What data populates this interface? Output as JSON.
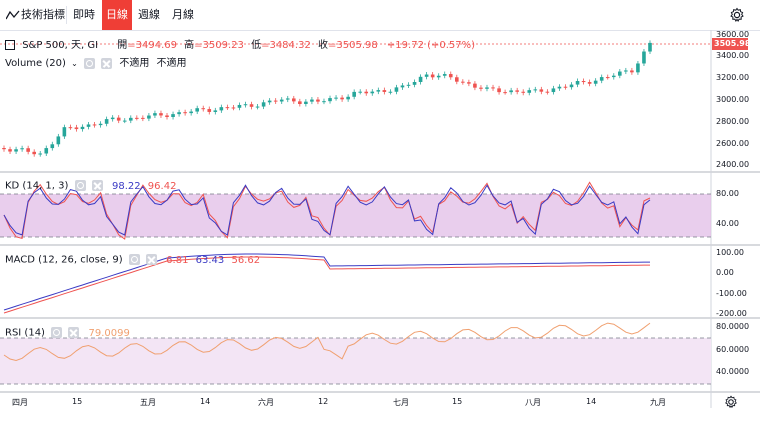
{
  "toolbar": {
    "indicators_label": "技術指標",
    "tabs": [
      {
        "label": "即時"
      },
      {
        "label": "日線",
        "active": true
      },
      {
        "label": "週線"
      },
      {
        "label": "月線"
      }
    ]
  },
  "main": {
    "symbol": "S&P 500, 天, GI",
    "open_label": "開",
    "open_value": "=3494.69",
    "high_label": "高",
    "high_value": "=3509.23",
    "low_label": "低",
    "low_value": "=3484.32",
    "close_label": "收",
    "close_value": "=3505.98",
    "change": "+19.72 (+0.57%)",
    "volume_label": "Volume (20)",
    "volume_na_1": "不適用",
    "volume_na_2": "不適用",
    "price_ticks": [
      "3600.00",
      "3400.00",
      "3200.00",
      "3000.00",
      "2800.00",
      "2600.00",
      "2400.00"
    ],
    "last_price_tag": "3505.98"
  },
  "kd": {
    "label": "KD (14, 1, 3)",
    "k_value": "98.22",
    "d_value": "96.42",
    "ticks": [
      "80.00",
      "40.00"
    ]
  },
  "macd": {
    "label": "MACD (12, 26, close, 9)",
    "v1": "6.81",
    "v2": "63.43",
    "v3": "56.62",
    "ticks": [
      "100.00",
      "0.00",
      "-100.00",
      "-200.00"
    ]
  },
  "rsi": {
    "label": "RSI (14)",
    "value": "79.0099",
    "ticks": [
      "80.0000",
      "60.0000",
      "40.0000"
    ]
  },
  "time_axis": [
    "四月",
    "15",
    "五月",
    "14",
    "六月",
    "12",
    "七月",
    "15",
    "八月",
    "14",
    "九月"
  ],
  "colors": {
    "up": "#26a69a",
    "down": "#ef5350",
    "accent": "#ef3e36",
    "k_line": "#3b3bc4",
    "d_line": "#ef5350",
    "rsi_line": "#f0a070",
    "band": "#e1bee7"
  }
}
